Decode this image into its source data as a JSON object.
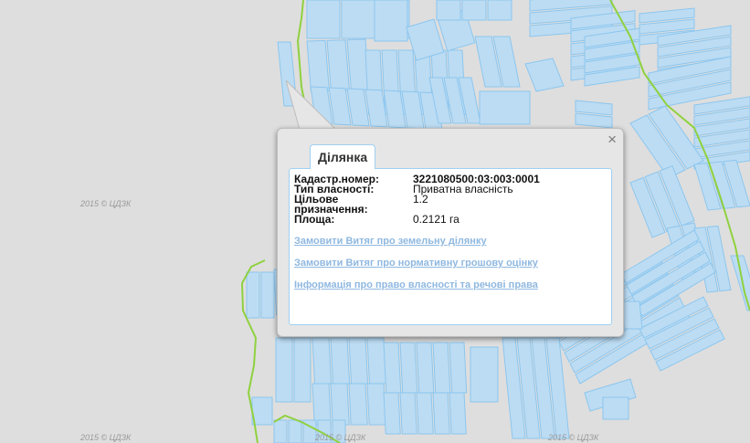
{
  "map": {
    "watermark": "2015 © ЦДЗК",
    "colors": {
      "background": "#dedede",
      "parcel_fill": "#bcdcf3",
      "parcel_stroke": "#8cc6ee",
      "boundary": "#8fd13f"
    }
  },
  "popup": {
    "tab_label": "Ділянка",
    "close_icon": "×",
    "fields": [
      {
        "label": "Кадастр.номер:",
        "value": "3221080500:03:003:0001"
      },
      {
        "label": "Тип власності:",
        "value": "Приватна власність"
      },
      {
        "label": "Цільове призначення:",
        "value": "1.2"
      },
      {
        "label": "Площа:",
        "value": "0.2121 га"
      }
    ],
    "links": [
      "Замовити Витяг про земельну ділянку",
      "Замовити Витяг про нормативну грошову оцінку",
      "Інформація про право власності та речові права"
    ]
  }
}
